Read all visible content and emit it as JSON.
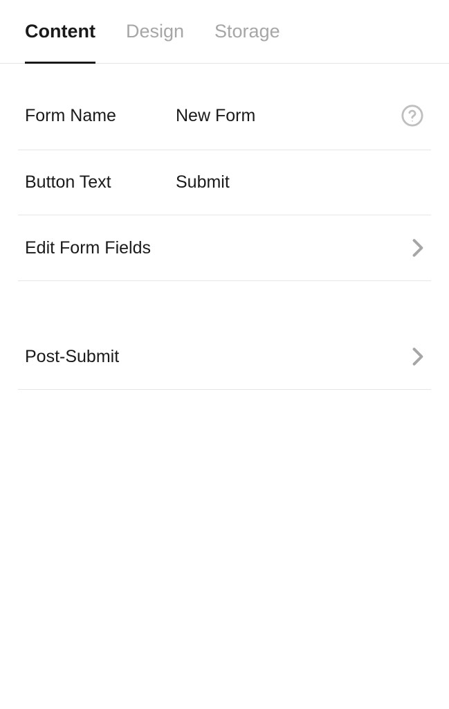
{
  "tabs": {
    "content": "Content",
    "design": "Design",
    "storage": "Storage"
  },
  "fields": {
    "form_name_label": "Form Name",
    "form_name_value": "New Form",
    "button_text_label": "Button Text",
    "button_text_value": "Submit",
    "edit_fields_label": "Edit Form Fields",
    "post_submit_label": "Post-Submit"
  }
}
